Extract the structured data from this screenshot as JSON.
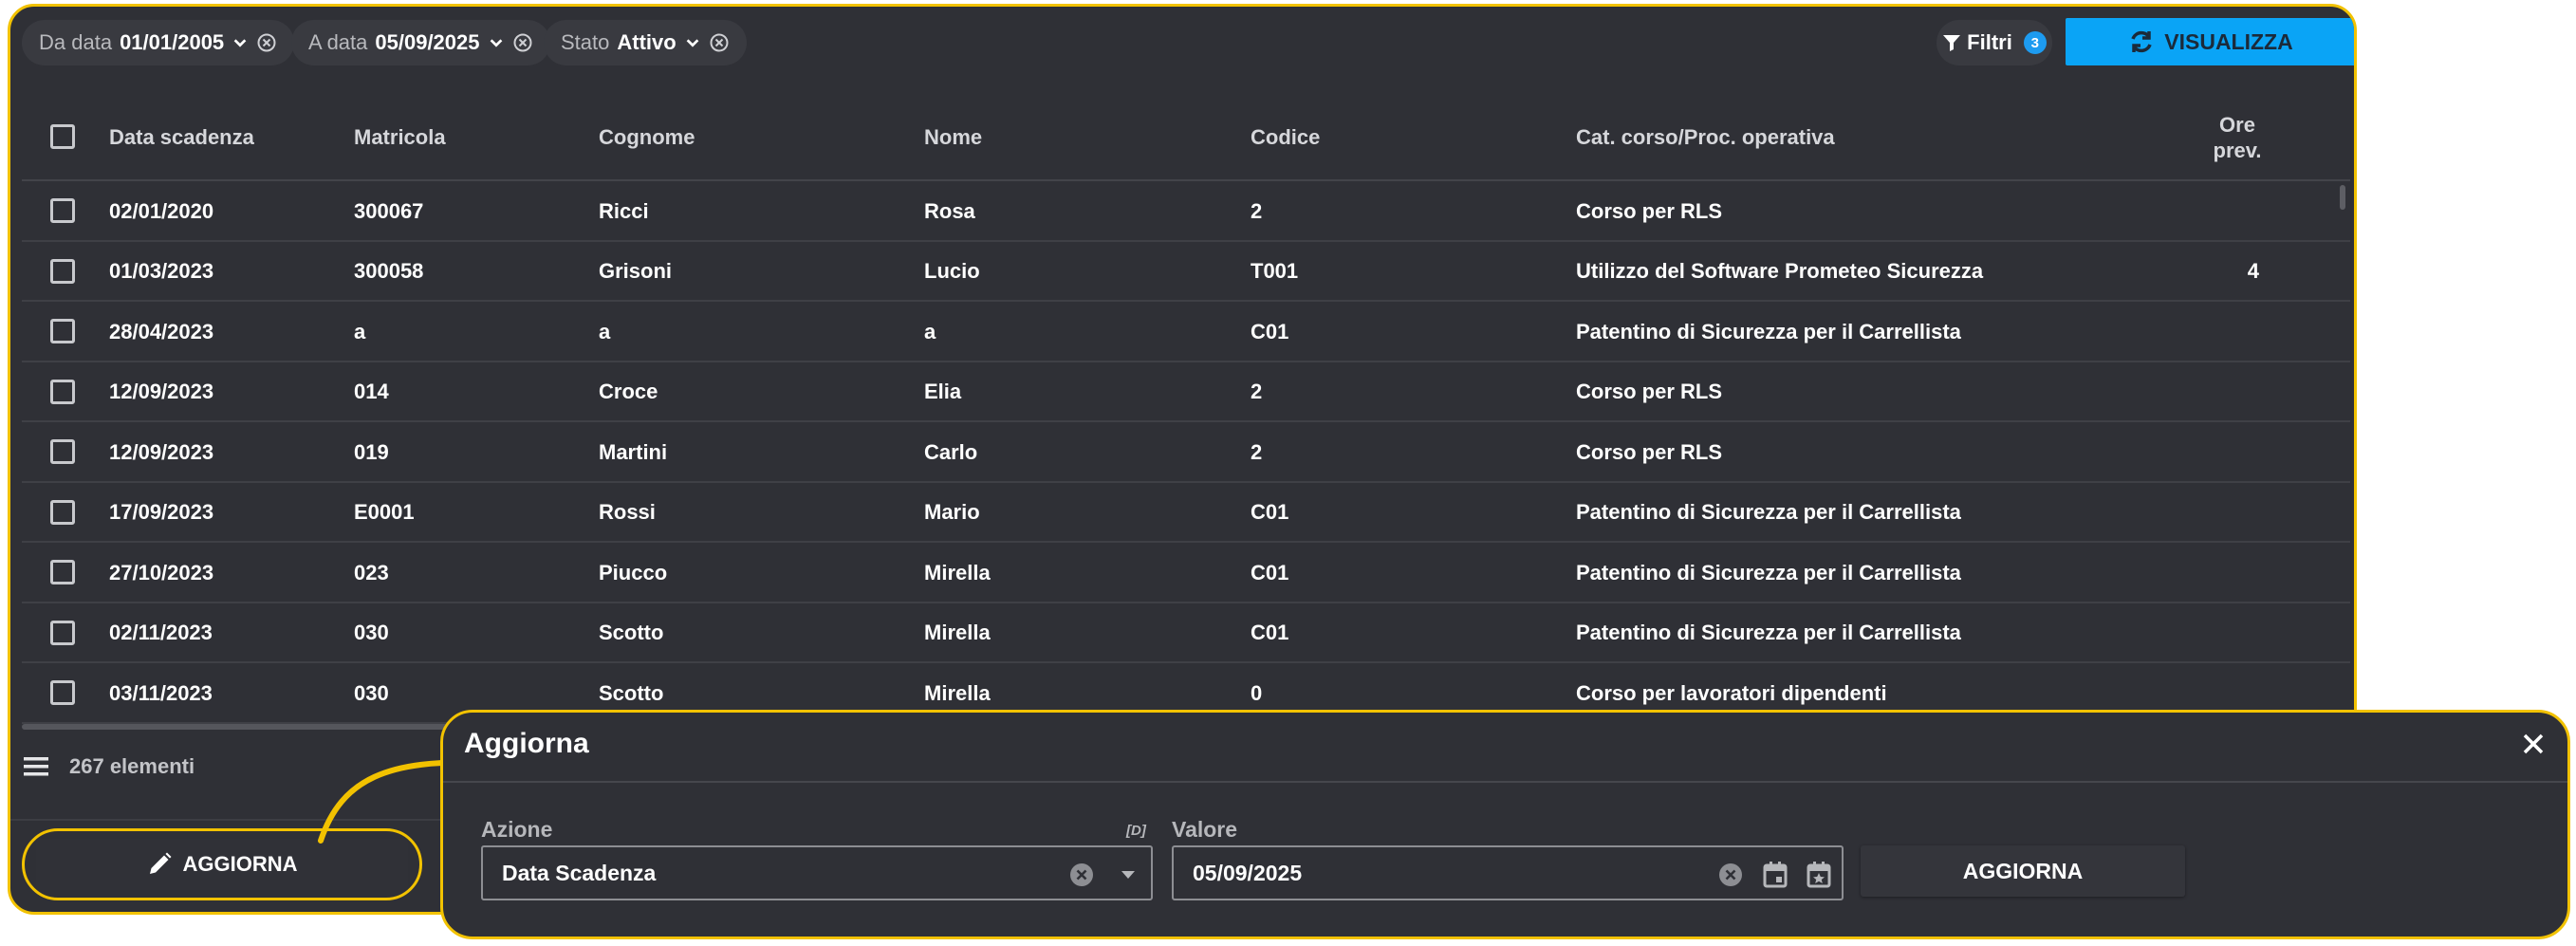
{
  "filters": {
    "da_data": {
      "label": "Da data",
      "value": "01/01/2005"
    },
    "a_data": {
      "label": "A data",
      "value": "05/09/2025"
    },
    "stato": {
      "label": "Stato",
      "value": "Attivo"
    },
    "filtri_label": "Filtri",
    "filtri_count": "3",
    "visualizza_label": "VISUALIZZA"
  },
  "table": {
    "columns": [
      "Data scadenza",
      "Matricola",
      "Cognome",
      "Nome",
      "Codice",
      "Cat. corso/Proc. operativa",
      "Ore prev."
    ],
    "column_ore_line1": "Ore",
    "column_ore_line2": "prev.",
    "rows": [
      {
        "data": "02/01/2020",
        "matricola": "300067",
        "cognome": "Ricci",
        "nome": "Rosa",
        "codice": "2",
        "cat": "Corso per RLS",
        "ore": ""
      },
      {
        "data": "01/03/2023",
        "matricola": "300058",
        "cognome": "Grisoni",
        "nome": "Lucio",
        "codice": "T001",
        "cat": "Utilizzo del Software Prometeo Sicurezza",
        "ore": "4"
      },
      {
        "data": "28/04/2023",
        "matricola": "a",
        "cognome": "a",
        "nome": "a",
        "codice": "C01",
        "cat": "Patentino di Sicurezza per il Carrellista",
        "ore": ""
      },
      {
        "data": "12/09/2023",
        "matricola": "014",
        "cognome": "Croce",
        "nome": "Elia",
        "codice": "2",
        "cat": "Corso per RLS",
        "ore": ""
      },
      {
        "data": "12/09/2023",
        "matricola": "019",
        "cognome": "Martini",
        "nome": "Carlo",
        "codice": "2",
        "cat": "Corso per RLS",
        "ore": ""
      },
      {
        "data": "17/09/2023",
        "matricola": "E0001",
        "cognome": "Rossi",
        "nome": "Mario",
        "codice": "C01",
        "cat": "Patentino di Sicurezza per il Carrellista",
        "ore": ""
      },
      {
        "data": "27/10/2023",
        "matricola": "023",
        "cognome": "Piucco",
        "nome": "Mirella",
        "codice": "C01",
        "cat": "Patentino di Sicurezza per il Carrellista",
        "ore": ""
      },
      {
        "data": "02/11/2023",
        "matricola": "030",
        "cognome": "Scotto",
        "nome": "Mirella",
        "codice": "C01",
        "cat": "Patentino di Sicurezza per il Carrellista",
        "ore": ""
      },
      {
        "data": "03/11/2023",
        "matricola": "030",
        "cognome": "Scotto",
        "nome": "Mirella",
        "codice": "0",
        "cat": "Corso per lavoratori dipendenti",
        "ore": ""
      }
    ]
  },
  "footer": {
    "count_label": "267 elementi",
    "aggiorna_label": "AGGIORNA"
  },
  "dialog": {
    "title": "Aggiorna",
    "azione_label": "Azione",
    "azione_hint": "[D]",
    "azione_value": "Data Scadenza",
    "valore_label": "Valore",
    "valore_value": "05/09/2025",
    "button_label": "AGGIORNA"
  },
  "colors": {
    "accent_yellow": "#f2c200",
    "primary_blue": "#0aa4f6",
    "panel_bg": "#2f3036"
  }
}
